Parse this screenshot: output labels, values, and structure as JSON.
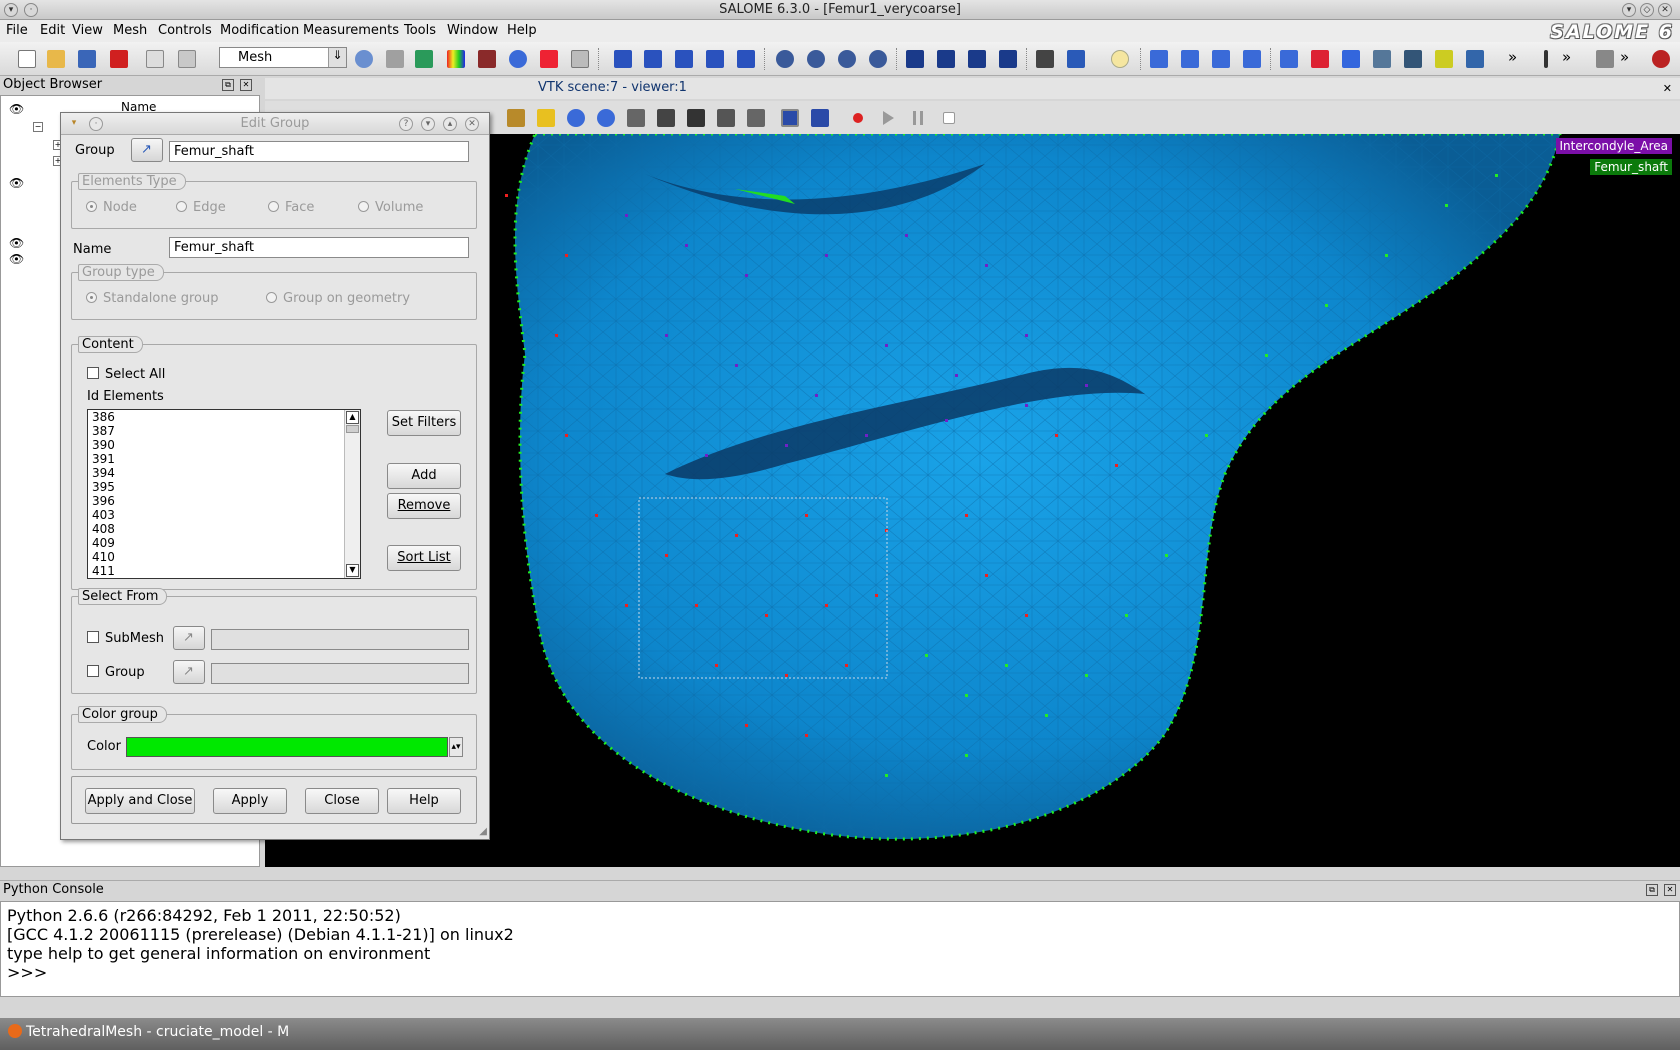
{
  "window": {
    "title": "SALOME 6.3.0 - [Femur1_verycoarse]",
    "logo": "SALOME 6"
  },
  "menu": [
    "File",
    "Edit",
    "View",
    "Mesh",
    "Controls",
    "Modification",
    "Measurements",
    "Tools",
    "Window",
    "Help"
  ],
  "toolbar": {
    "module": "Mesh",
    "overflow": "»"
  },
  "object_browser": {
    "title": "Object Browser",
    "column": "Name"
  },
  "viewer": {
    "title": "VTK scene:7 - viewer:1",
    "legend": [
      {
        "label": "Intercondyle_Area",
        "color": "#7b0fa8"
      },
      {
        "label": "Femur_shaft",
        "color": "#0b7a0b"
      }
    ]
  },
  "dialog": {
    "title": "Edit Group",
    "group_label": "Group",
    "group_value": "Femur_shaft",
    "elements_type": {
      "title": "Elements Type",
      "options": [
        "Node",
        "Edge",
        "Face",
        "Volume"
      ],
      "selected": "Node"
    },
    "name_label": "Name",
    "name_value": "Femur_shaft",
    "group_type": {
      "title": "Group type",
      "options": [
        "Standalone group",
        "Group on geometry"
      ],
      "selected": "Standalone group"
    },
    "content": {
      "title": "Content",
      "select_all": "Select All",
      "id_label": "Id Elements",
      "ids": [
        "386",
        "387",
        "390",
        "391",
        "394",
        "395",
        "396",
        "403",
        "408",
        "409",
        "410",
        "411"
      ],
      "buttons": {
        "set_filters": "Set Filters",
        "add": "Add",
        "remove": "Remove",
        "sort_list": "Sort List"
      }
    },
    "select_from": {
      "title": "Select From",
      "submesh": "SubMesh",
      "group": "Group"
    },
    "color_group": {
      "title": "Color group",
      "label": "Color",
      "value": "#00e800"
    },
    "buttons": {
      "apply_close": "Apply and Close",
      "apply": "Apply",
      "close": "Close",
      "help": "Help"
    }
  },
  "python_console": {
    "title": "Python Console",
    "lines": [
      "Python 2.6.6 (r266:84292, Feb  1 2011, 22:50:52)",
      "[GCC 4.1.2 20061115 (prerelease) (Debian 4.1.1-21)] on linux2",
      "type help to get general information on environment",
      ">>>"
    ]
  },
  "taskbar": {
    "item": "TetrahedralMesh - cruciate_model - M"
  }
}
